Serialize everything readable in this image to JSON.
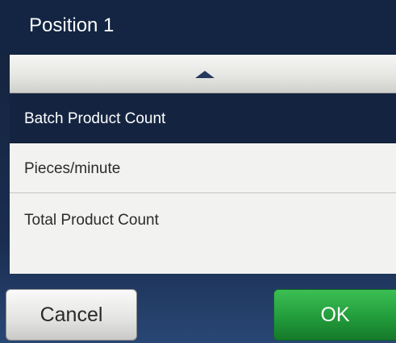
{
  "title_bar": {
    "title": "Position 1"
  },
  "list": {
    "scroll_up_icon": "triangle-up",
    "scroll_down_icon": "triangle-down",
    "items": [
      {
        "label": "Batch Product Count",
        "selected": true
      },
      {
        "label": "Pieces/minute",
        "selected": false
      },
      {
        "label": "Total Product Count",
        "selected": false
      }
    ]
  },
  "footer": {
    "cancel_label": "Cancel",
    "ok_label": "OK"
  },
  "colors": {
    "title_bar_bg": "#132543",
    "selected_item_bg": "#142440",
    "ok_button": "#229c3b",
    "list_bg": "#f2f2f0"
  }
}
